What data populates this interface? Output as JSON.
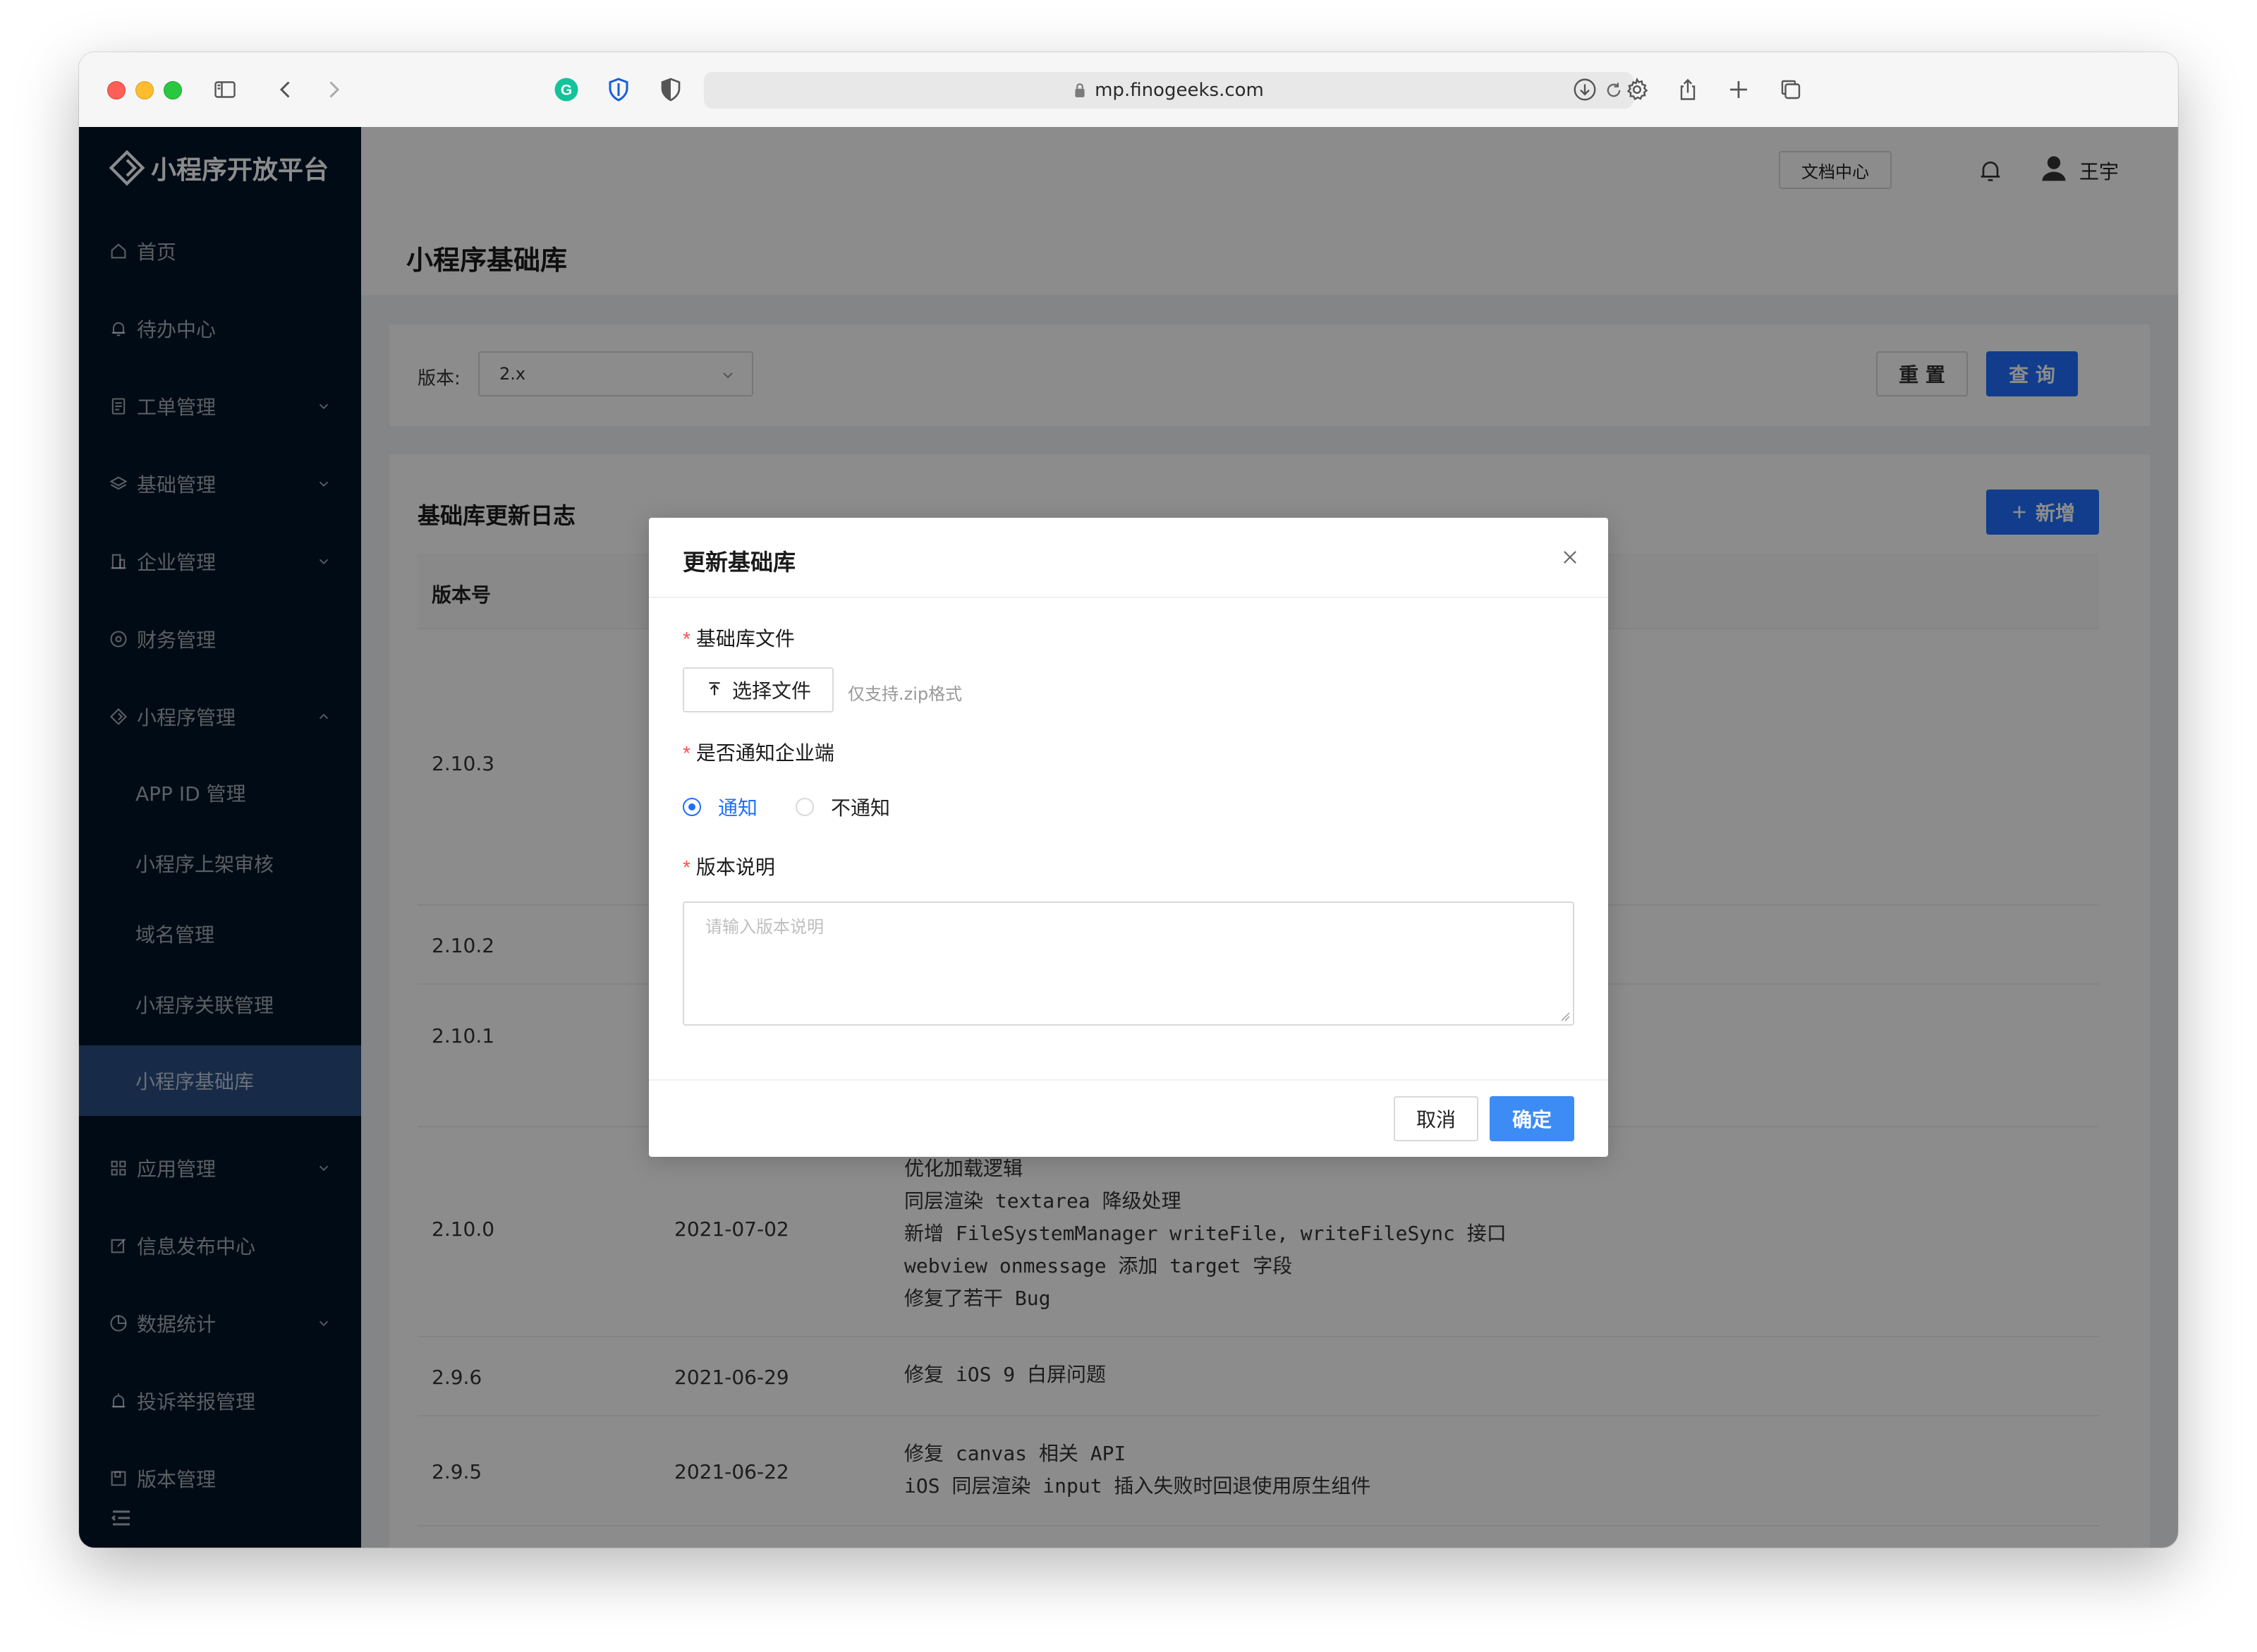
{
  "browser": {
    "url": "mp.finogeeks.com"
  },
  "sidebar": {
    "app_title": "小程序开放平台",
    "items": [
      {
        "label": "首页",
        "icon": "home-icon"
      },
      {
        "label": "待办中心",
        "icon": "bell-icon"
      },
      {
        "label": "工单管理",
        "icon": "document-icon"
      },
      {
        "label": "基础管理",
        "icon": "layers-icon"
      },
      {
        "label": "企业管理",
        "icon": "building-icon"
      },
      {
        "label": "财务管理",
        "icon": "money-icon"
      },
      {
        "label": "小程序管理",
        "icon": "diamond-icon"
      }
    ],
    "sub_items": [
      "APP ID 管理",
      "小程序上架审核",
      "域名管理",
      "小程序关联管理",
      "小程序基础库"
    ],
    "more_items": [
      {
        "label": "应用管理",
        "icon": "grid-icon"
      },
      {
        "label": "信息发布中心",
        "icon": "edit-icon"
      },
      {
        "label": "数据统计",
        "icon": "pie-chart-icon"
      },
      {
        "label": "投诉举报管理",
        "icon": "alarm-icon"
      },
      {
        "label": "版本管理",
        "icon": "save-icon"
      }
    ]
  },
  "header": {
    "doc_center": "文档中心",
    "user_name": "王宇"
  },
  "page": {
    "title": "小程序基础库",
    "filter": {
      "version_label": "版本:",
      "version_value": "2.x",
      "reset": "重 置",
      "query": "查 询"
    },
    "table": {
      "title": "基础库更新日志",
      "add": "新增",
      "columns": [
        "版本号"
      ],
      "rows": [
        {
          "version": "2.10.3",
          "date": "",
          "notes": ""
        },
        {
          "version": "2.10.2",
          "date": "",
          "notes": ""
        },
        {
          "version": "2.10.1",
          "date": "",
          "notes": ""
        },
        {
          "version": "2.10.0",
          "date": "2021-07-02",
          "notes": "优化加载逻辑\n同层渲染 textarea 降级处理\n新增 FileSystemManager writeFile, writeFileSync 接口\nwebview onmessage 添加 target 字段\n修复了若干 Bug"
        },
        {
          "version": "2.9.6",
          "date": "2021-06-29",
          "notes": "修复 iOS 9 白屏问题"
        },
        {
          "version": "2.9.5",
          "date": "2021-06-22",
          "notes": "修复 canvas 相关 API\niOS 同层渲染 input 插入失败时回退使用原生组件"
        }
      ]
    }
  },
  "modal": {
    "title": "更新基础库",
    "file_label": "基础库文件",
    "upload_button": "选择文件",
    "upload_hint": "仅支持.zip格式",
    "notify_label": "是否通知企业端",
    "notify_options": [
      "通知",
      "不通知"
    ],
    "notify_selected": "通知",
    "desc_label": "版本说明",
    "desc_placeholder": "请输入版本说明",
    "cancel": "取消",
    "ok": "确定"
  },
  "colors": {
    "sidebar_bg": "#001529",
    "primary": "#1f6fff",
    "required": "#ff4d4f"
  }
}
